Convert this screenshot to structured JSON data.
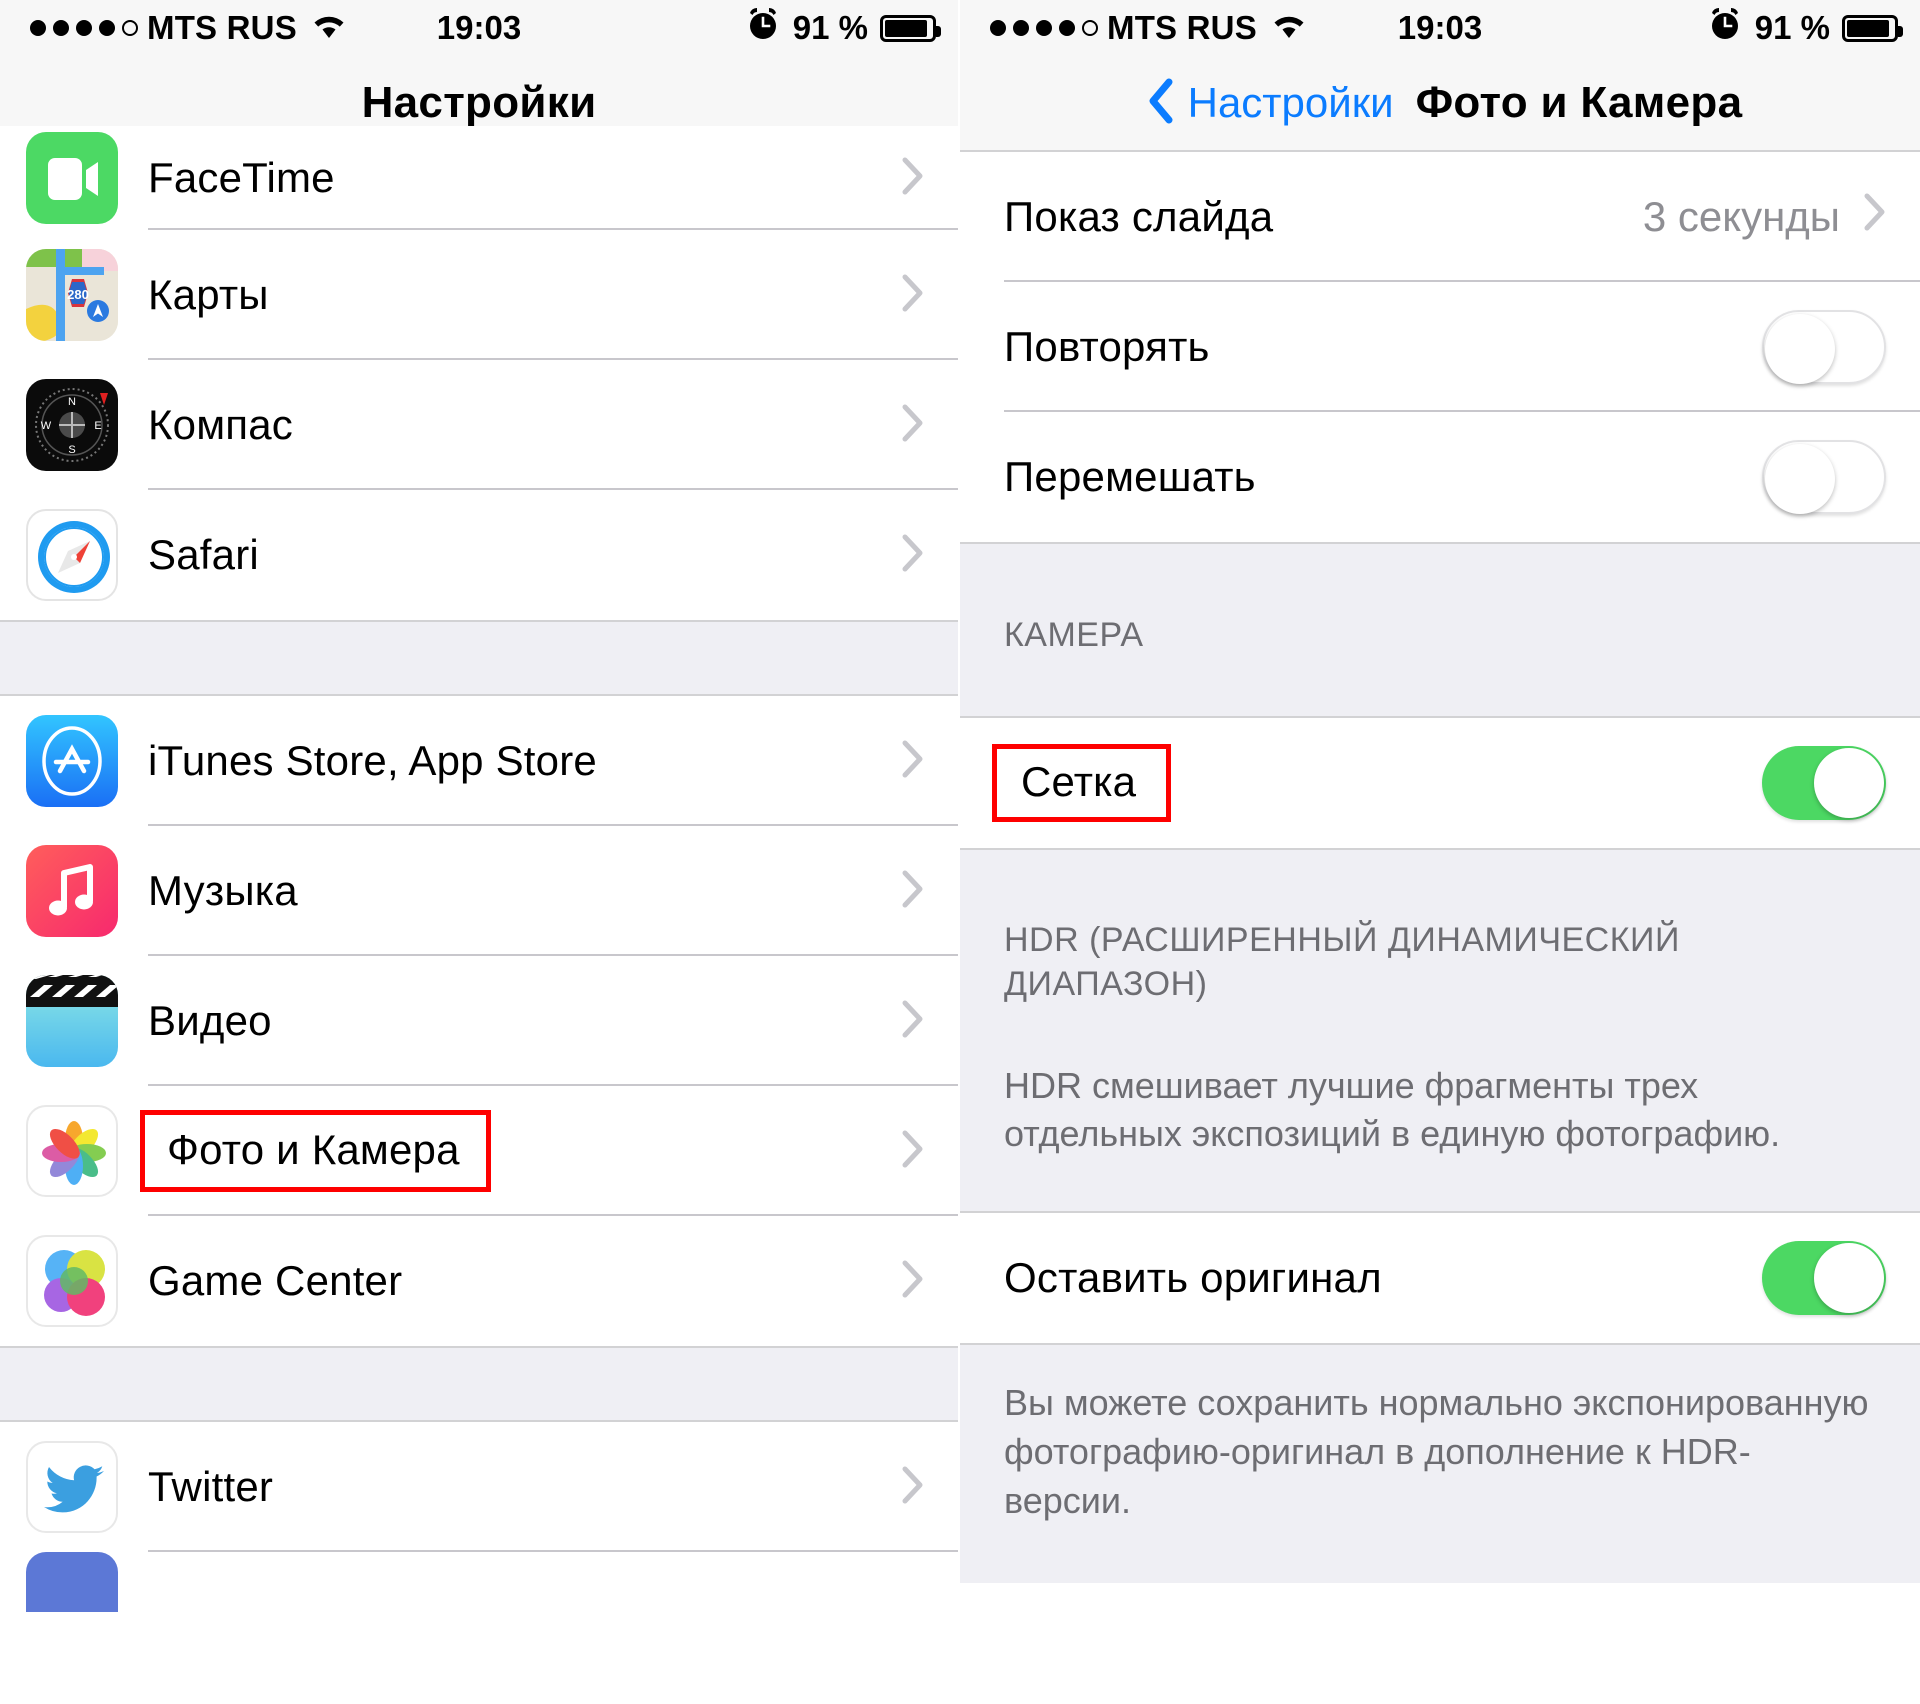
{
  "status_bar": {
    "signal_dots_filled": 4,
    "signal_dots_total": 5,
    "carrier": "MTS RUS",
    "wifi_icon": "wifi-icon",
    "time": "19:03",
    "alarm_icon": "alarm-clock-icon",
    "battery_percent": "91 %",
    "battery_level": 91
  },
  "left_screen": {
    "nav": {
      "title": "Настройки"
    },
    "rows": [
      {
        "label": "FaceTime",
        "icon": "facetime-icon",
        "chevron": "chevron-right-icon",
        "highlighted": false
      },
      {
        "label": "Карты",
        "icon": "maps-icon",
        "chevron": "chevron-right-icon",
        "highlighted": false
      },
      {
        "label": "Компас",
        "icon": "compass-icon",
        "chevron": "chevron-right-icon",
        "highlighted": false
      },
      {
        "label": "Safari",
        "icon": "safari-icon",
        "chevron": "chevron-right-icon",
        "highlighted": false
      },
      {
        "label": "iTunes Store, App Store",
        "icon": "app-store-icon",
        "chevron": "chevron-right-icon",
        "highlighted": false
      },
      {
        "label": "Музыка",
        "icon": "music-icon",
        "chevron": "chevron-right-icon",
        "highlighted": false
      },
      {
        "label": "Видео",
        "icon": "video-icon",
        "chevron": "chevron-right-icon",
        "highlighted": false
      },
      {
        "label": "Фото и Камера",
        "icon": "photos-icon",
        "chevron": "chevron-right-icon",
        "highlighted": true
      },
      {
        "label": "Game Center",
        "icon": "game-center-icon",
        "chevron": "chevron-right-icon",
        "highlighted": false
      },
      {
        "label": "Twitter",
        "icon": "twitter-icon",
        "chevron": "chevron-right-icon",
        "highlighted": false
      }
    ]
  },
  "right_screen": {
    "nav": {
      "back_label": "Настройки",
      "back_icon": "chevron-left-icon",
      "title": "Фото и Камера"
    },
    "slideshow_rows": [
      {
        "label": "Показ слайда",
        "value": "3 секунды",
        "control": "disclosure",
        "chevron": "chevron-right-icon"
      },
      {
        "label": "Повторять",
        "control": "toggle",
        "toggle_on": false
      },
      {
        "label": "Перемешать",
        "control": "toggle",
        "toggle_on": false
      }
    ],
    "camera_section": {
      "header": "КАМЕРА",
      "row": {
        "label": "Сетка",
        "control": "toggle",
        "toggle_on": true,
        "highlighted": true
      }
    },
    "hdr_section": {
      "header": "HDR (РАСШИРЕННЫЙ ДИНАМИЧЕСКИЙ ДИАПАЗОН)",
      "body": "HDR смешивает лучшие фрагменты трех отдельных экспозиций в единую фотографию.",
      "row": {
        "label": "Оставить оригинал",
        "control": "toggle",
        "toggle_on": true
      },
      "footer": "Вы можете сохранить нормально экспонированную фотографию-оригинал в дополнение к HDR-версии."
    }
  },
  "colors": {
    "accent_blue": "#0b7cff",
    "toggle_green": "#4cd863",
    "highlight_red": "#fe0000",
    "group_bg": "#efeff4",
    "separator": "#c8c7cc",
    "secondary_text": "#8e8e93",
    "muted_text": "#6d6d72"
  }
}
